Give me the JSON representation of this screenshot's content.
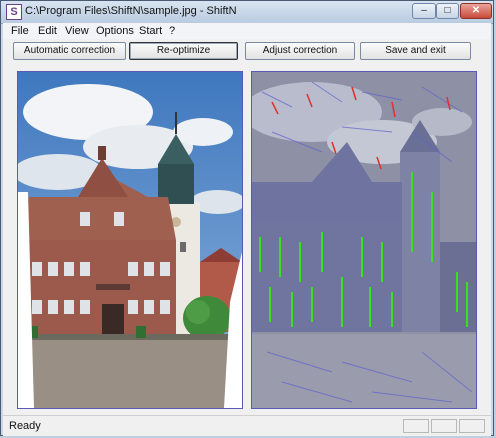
{
  "window": {
    "title": "C:\\Program Files\\ShiftN\\sample.jpg - ShiftN",
    "app_icon_letter": "S",
    "controls": {
      "minimize": "–",
      "maximize": "□",
      "close": "✕"
    }
  },
  "menu": [
    {
      "label": "File"
    },
    {
      "label": "Edit"
    },
    {
      "label": "View"
    },
    {
      "label": "Options"
    },
    {
      "label": "Start"
    },
    {
      "label": "?"
    }
  ],
  "toolbar": {
    "buttons": [
      {
        "label": "Automatic correction"
      },
      {
        "label": "Re-optimize"
      },
      {
        "label": "Adjust correction"
      },
      {
        "label": "Save and exit"
      }
    ]
  },
  "status": {
    "text": "Ready"
  },
  "colors": {
    "accent_frame": "#5a5ab4",
    "detected_lines_green": "#38e01e",
    "detected_lines_red": "#e0302a",
    "overlay_blue": "#5d63c9"
  },
  "images": {
    "left": "corrected-photo",
    "right": "line-detection-preview"
  }
}
